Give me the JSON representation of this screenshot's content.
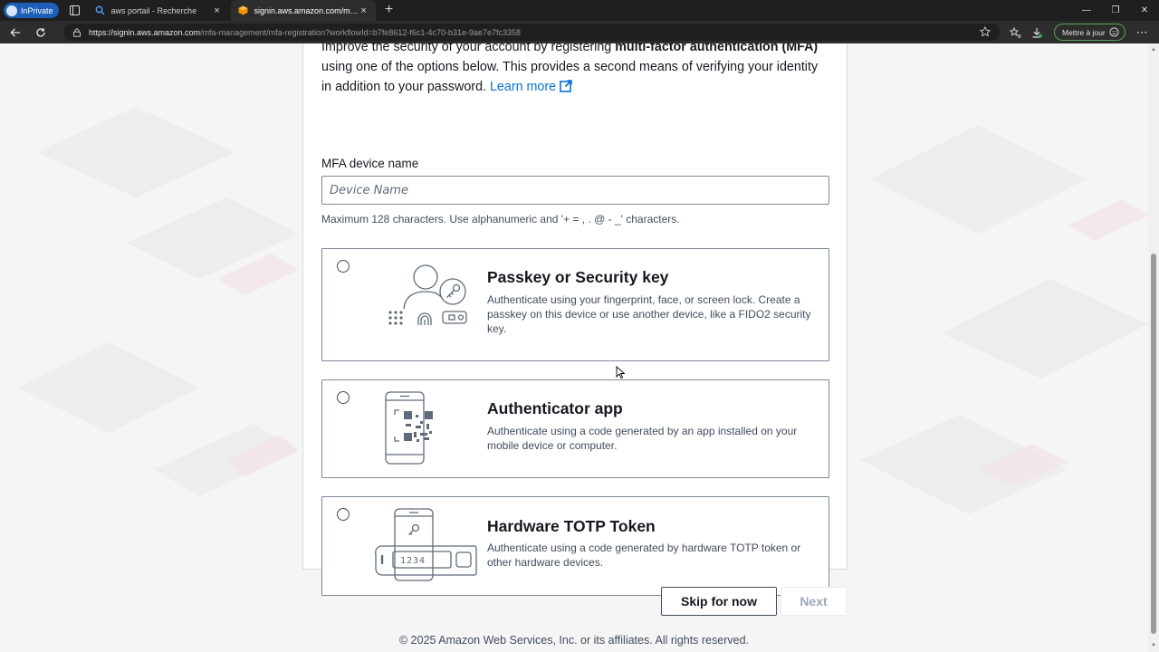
{
  "browser": {
    "inprivate_label": "InPrivate",
    "tabs": [
      {
        "title": "aws portail - Recherche",
        "active": false
      },
      {
        "title": "signin.aws.amazon.com/mfa-man",
        "active": true
      }
    ],
    "url_host": "https://signin.aws.amazon.com",
    "url_path": "/mfa-management/mfa-registration?workflowId=b7fe8612-f6c1-4c70-b31e-9ae7e7fc3358",
    "update_label": "Mettre à jour"
  },
  "page": {
    "intro_start": "Improve the security of your account by registering ",
    "intro_bold": "multi-factor authentication (MFA)",
    "intro_end": " using one of the options below. This provides a second means of verifying your identity in addition to your password.",
    "learn_more": "Learn more",
    "device_label": "MFA device name",
    "device_placeholder": "Device Name",
    "device_value": "",
    "device_hint": "Maximum 128 characters. Use alphanumeric and '+ = , . @ - _' characters.",
    "options": [
      {
        "title": "Passkey or Security key",
        "description": "Authenticate using your fingerprint, face, or screen lock. Create a passkey on this device or use another device, like a FIDO2 security key."
      },
      {
        "title": "Authenticator app",
        "description": "Authenticate using a code generated by an app installed on your mobile device or computer."
      },
      {
        "title": "Hardware TOTP Token",
        "description": "Authenticate using a code generated by hardware TOTP token or other hardware devices."
      }
    ],
    "token_display": "1234",
    "skip_label": "Skip for now",
    "next_label": "Next",
    "footer": "© 2025 Amazon Web Services, Inc. or its affiliates. All rights reserved."
  },
  "icons": {
    "illustration_stroke": "#5f6b7a",
    "link_color": "#0972d3"
  }
}
